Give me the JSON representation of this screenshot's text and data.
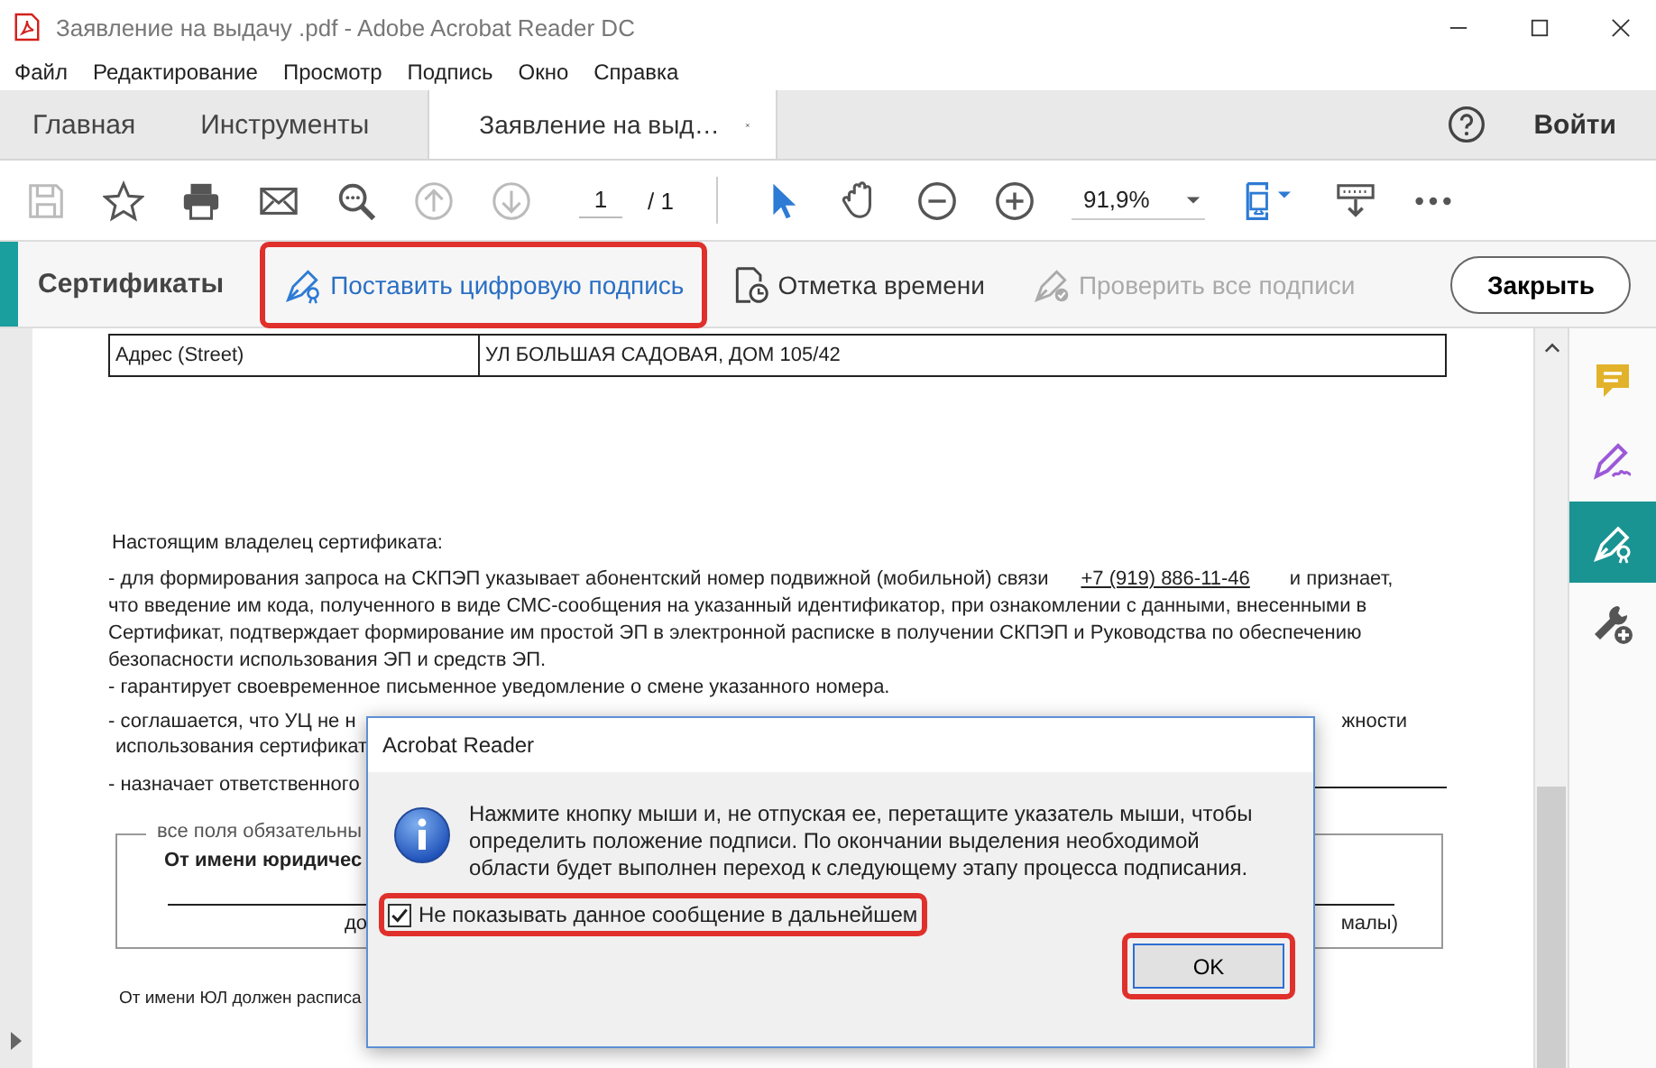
{
  "window": {
    "title": "Заявление на выдачу .pdf - Adobe Acrobat Reader DC"
  },
  "menu": [
    "Файл",
    "Редактирование",
    "Просмотр",
    "Подпись",
    "Окно",
    "Справка"
  ],
  "tabs": [
    {
      "label": "Главная",
      "selected": false,
      "kind": "nav"
    },
    {
      "label": "Инструменты",
      "selected": false,
      "kind": "nav"
    },
    {
      "label": "Заявление на выд…",
      "selected": true,
      "kind": "document"
    }
  ],
  "sign_in": "Войти",
  "toolbar": {
    "page": "1",
    "page_total": "/ 1",
    "zoom": "91,9%"
  },
  "certificates": {
    "title": "Сертификаты",
    "actions": [
      {
        "label": "Поставить цифровую подпись",
        "disabled": false,
        "highlighted": true,
        "kind": "sign"
      },
      {
        "label": "Отметка времени",
        "disabled": false,
        "highlighted": false,
        "kind": "timestamp"
      },
      {
        "label": "Проверить все подписи",
        "disabled": true,
        "highlighted": false,
        "kind": "verify"
      }
    ],
    "close": "Закрыть"
  },
  "document": {
    "table_row": [
      "Адрес (Street)",
      "УЛ БОЛЬШАЯ САДОВАЯ, ДОМ 105/42"
    ],
    "heading": "Настоящим владелец сертификата:",
    "lines": [
      {
        "text": "- для формирования запроса на СКПЭП указывает абонентский номер подвижной (мобильной) связи",
        "phone": "+7 (919) 886-11-46",
        "tail": "и признает,"
      },
      {
        "text": "что введение им кода, полученного в виде СМС-сообщения на указанный идентификатор, при ознакомлении с данными, внесенными в"
      },
      {
        "text": "Сертификат, подтверждает формирование им простой ЭП в электронной расписке в получении СКПЭП и Руководства по обеспечению"
      },
      {
        "text": "безопасности использования ЭП и средств ЭП."
      },
      {
        "text": "- гарантирует своевременное письменное уведомление о смене указанного номера."
      }
    ],
    "partial_lines": [
      {
        "left": "- соглашается, что УЦ не н",
        "right": "жности"
      },
      {
        "left": "использования сертификат"
      },
      {
        "left": "- назначает ответственного"
      }
    ],
    "fieldset": {
      "legend": "все поля обязательны",
      "title": "От имени юридичес",
      "caption_left": "до",
      "caption_right": "малы)"
    },
    "footer": "От имени ЮЛ должен расписа"
  },
  "tools": [
    {
      "kind": "comment",
      "selected": false
    },
    {
      "kind": "fill-sign",
      "selected": false
    },
    {
      "kind": "certificates",
      "selected": true
    },
    {
      "kind": "more-tools",
      "selected": false
    }
  ],
  "dialog": {
    "title": "Acrobat Reader",
    "message": "Нажмите кнопку мыши и, не отпуская ее, перетащите указатель мыши, чтобы определить положение подписи. По окончании выделения необходимой области будет выполнен переход к следующему этапу процесса подписания.",
    "checkbox": {
      "label": "Не показывать данное сообщение в дальнейшем",
      "checked": true,
      "highlighted": true
    },
    "ok": {
      "label": "OK",
      "highlighted": true
    }
  }
}
